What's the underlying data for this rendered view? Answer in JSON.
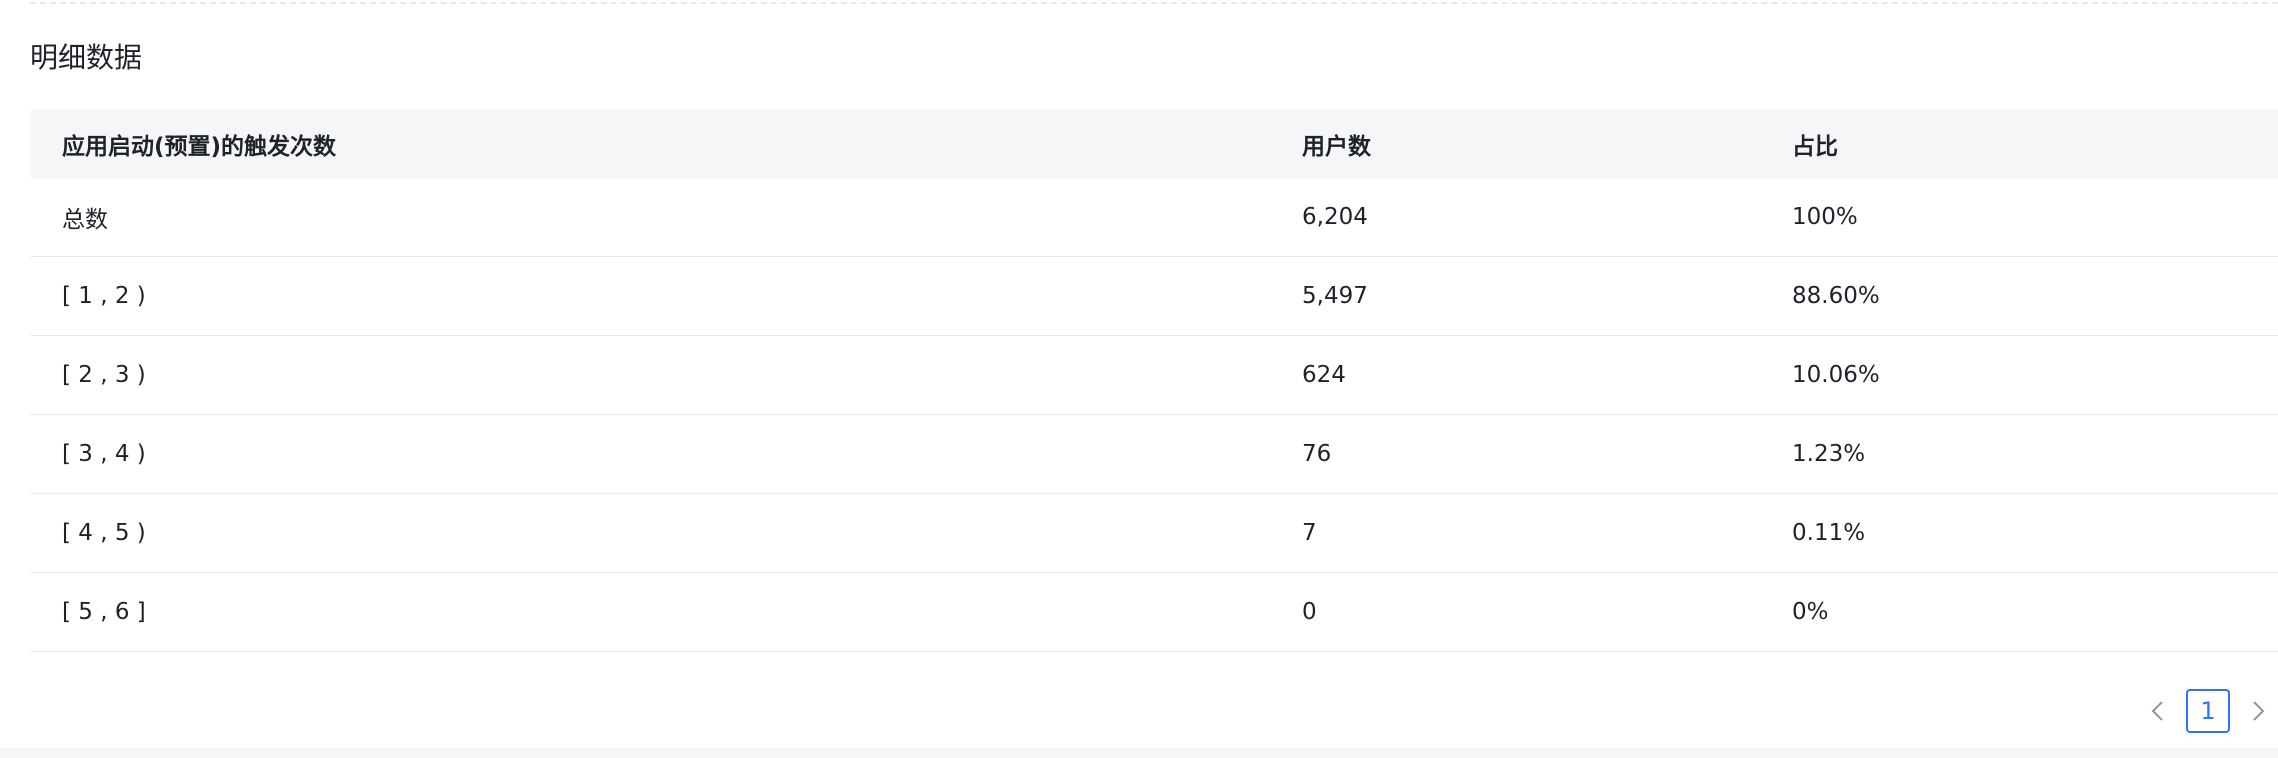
{
  "section": {
    "title": "明细数据"
  },
  "table": {
    "columns": [
      "应用启动(预置)的触发次数",
      "用户数",
      "占比"
    ],
    "rows": [
      {
        "range": "总数",
        "users": "6,204",
        "ratio": "100%"
      },
      {
        "range": "[ 1 , 2 )",
        "users": "5,497",
        "ratio": "88.60%"
      },
      {
        "range": "[ 2 , 3 )",
        "users": "624",
        "ratio": "10.06%"
      },
      {
        "range": "[ 3 , 4 )",
        "users": "76",
        "ratio": "1.23%"
      },
      {
        "range": "[ 4 , 5 )",
        "users": "7",
        "ratio": "0.11%"
      },
      {
        "range": "[ 5 , 6 ]",
        "users": "0",
        "ratio": "0%"
      }
    ]
  },
  "pagination": {
    "current_page": "1",
    "prev_icon": "chevron-left-icon",
    "next_icon": "chevron-right-icon"
  },
  "colors": {
    "accent": "#3370ff",
    "header_bg": "#f5f6f8",
    "text": "#1f2329"
  }
}
